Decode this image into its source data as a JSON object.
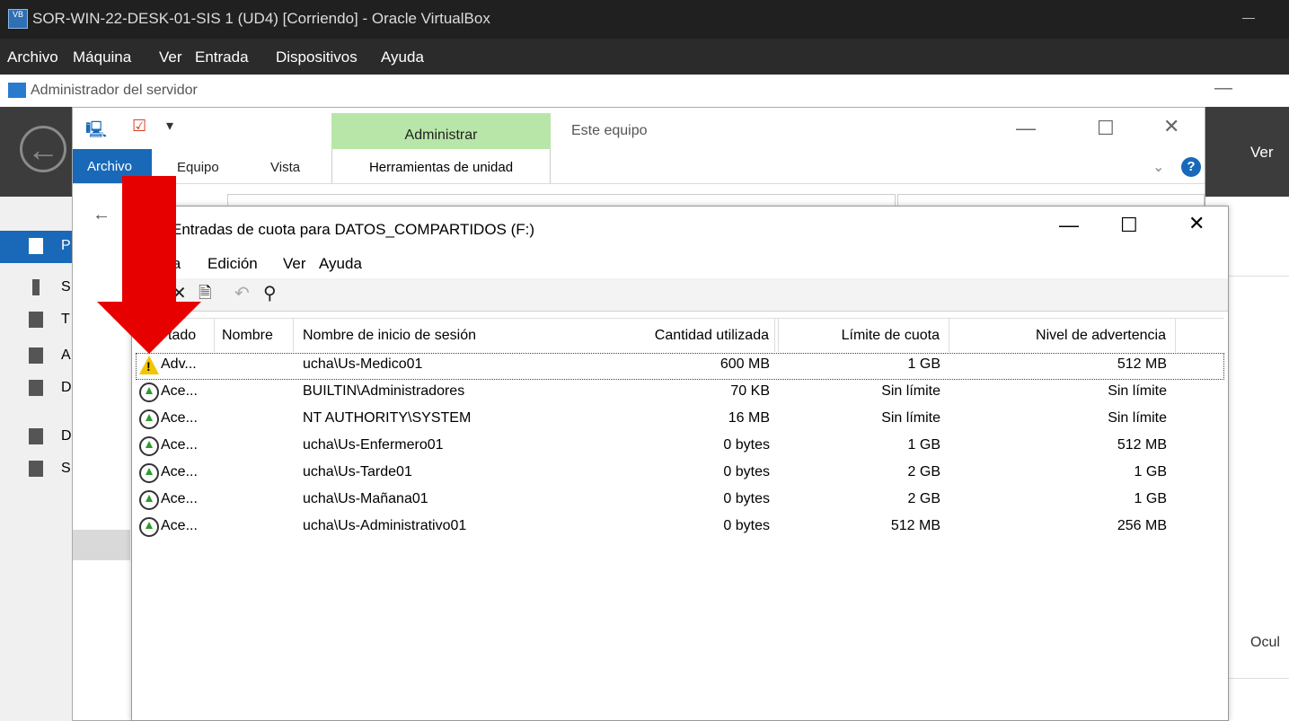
{
  "vbox": {
    "title": "SOR-WIN-22-DESK-01-SIS 1 (UD4) [Corriendo] - Oracle VirtualBox",
    "menu": [
      "Archivo",
      "Máquina",
      "Ver",
      "Entrada",
      "Dispositivos",
      "Ayuda"
    ]
  },
  "server_manager": {
    "title": "Administrador del servidor",
    "ver_label": "Ver",
    "ocul_label": "Ocul",
    "sidebar": [
      {
        "label": "P",
        "icon": "dashboard-icon"
      },
      {
        "label": "S",
        "icon": "local-server-icon"
      },
      {
        "label": "T",
        "icon": "all-servers-icon"
      },
      {
        "label": "A",
        "icon": "ad-icon"
      },
      {
        "label": "D",
        "icon": "dns-icon"
      },
      {
        "label": "D",
        "icon": "file-services-icon"
      },
      {
        "label": "S",
        "icon": "storage-icon"
      }
    ]
  },
  "explorer": {
    "admin_tab": "Administrar",
    "location": "Este equipo",
    "tabs": {
      "archivo": "Archivo",
      "equipo": "Equipo",
      "vista": "Vista",
      "herramientas": "Herramientas de unidad"
    }
  },
  "quota_window": {
    "title": "Entradas de cuota para DATOS_COMPARTIDOS (F:)",
    "menu": [
      "ta",
      "Edición",
      "Ver",
      "Ayuda"
    ],
    "columns": [
      "tado",
      "Nombre",
      "Nombre de inicio de sesión",
      "Cantidad utilizada",
      "Límite de cuota",
      "Nivel de advertencia"
    ],
    "rows": [
      {
        "status": "Adv...",
        "status_icon": "warning-icon",
        "name": "",
        "login": "ucha\\Us-Medico01",
        "used": "600 MB",
        "limit": "1 GB",
        "warning": "512 MB"
      },
      {
        "status": "Ace...",
        "status_icon": "ok-icon",
        "name": "",
        "login": "BUILTIN\\Administradores",
        "used": "70 KB",
        "limit": "Sin límite",
        "warning": "Sin límite"
      },
      {
        "status": "Ace...",
        "status_icon": "ok-icon",
        "name": "",
        "login": "NT AUTHORITY\\SYSTEM",
        "used": "16 MB",
        "limit": "Sin límite",
        "warning": "Sin límite"
      },
      {
        "status": "Ace...",
        "status_icon": "ok-icon",
        "name": "",
        "login": "ucha\\Us-Enfermero01",
        "used": "0 bytes",
        "limit": "1 GB",
        "warning": "512 MB"
      },
      {
        "status": "Ace...",
        "status_icon": "ok-icon",
        "name": "",
        "login": "ucha\\Us-Tarde01",
        "used": "0 bytes",
        "limit": "2 GB",
        "warning": "1 GB"
      },
      {
        "status": "Ace...",
        "status_icon": "ok-icon",
        "name": "",
        "login": "ucha\\Us-Mañana01",
        "used": "0 bytes",
        "limit": "2 GB",
        "warning": "1 GB"
      },
      {
        "status": "Ace...",
        "status_icon": "ok-icon",
        "name": "",
        "login": "ucha\\Us-Administrativo01",
        "used": "0 bytes",
        "limit": "512 MB",
        "warning": "256 MB"
      }
    ]
  },
  "annotation": {
    "color": "#e60000"
  }
}
